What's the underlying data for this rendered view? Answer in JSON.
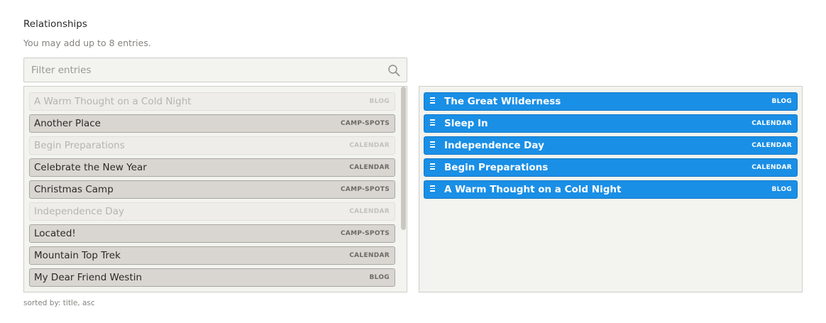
{
  "field": {
    "label": "Relationships",
    "instructions": "You may add up to 8 entries."
  },
  "filter": {
    "placeholder": "Filter entries",
    "icon": "search-icon"
  },
  "available_entries": [
    {
      "title": "A Warm Thought on a Cold Night",
      "tag": "BLOG",
      "disabled": true
    },
    {
      "title": "Another Place",
      "tag": "CAMP-SPOTS",
      "disabled": false
    },
    {
      "title": "Begin Preparations",
      "tag": "CALENDAR",
      "disabled": true
    },
    {
      "title": "Celebrate the New Year",
      "tag": "CALENDAR",
      "disabled": false
    },
    {
      "title": "Christmas Camp",
      "tag": "CAMP-SPOTS",
      "disabled": false
    },
    {
      "title": "Independence Day",
      "tag": "CALENDAR",
      "disabled": true
    },
    {
      "title": "Located!",
      "tag": "CAMP-SPOTS",
      "disabled": false
    },
    {
      "title": "Mountain Top Trek",
      "tag": "CALENDAR",
      "disabled": false
    },
    {
      "title": "My Dear Friend Westin",
      "tag": "BLOG",
      "disabled": false
    }
  ],
  "chosen_entries": [
    {
      "title": "The Great Wilderness",
      "tag": "BLOG"
    },
    {
      "title": "Sleep In",
      "tag": "CALENDAR"
    },
    {
      "title": "Independence Day",
      "tag": "CALENDAR"
    },
    {
      "title": "Begin Preparations",
      "tag": "CALENDAR"
    },
    {
      "title": "A Warm Thought on a Cold Night",
      "tag": "BLOG"
    }
  ],
  "sort_note": "sorted by: title, asc",
  "colors": {
    "chosen_bg": "#1a8fe6",
    "entry_bg": "#d9d6d1",
    "panel_bg": "#f3f3ef"
  }
}
